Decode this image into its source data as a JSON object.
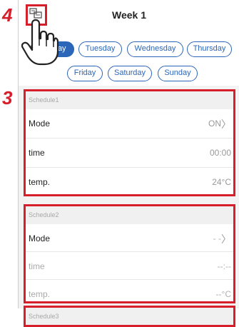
{
  "steps": {
    "step4": "4",
    "step3": "3"
  },
  "header": {
    "title": "Week 1",
    "icon": "copy-schedule-icon"
  },
  "days": [
    "Monday",
    "Tuesday",
    "Wednesday",
    "Thursday",
    "Friday",
    "Saturday",
    "Sunday"
  ],
  "selected_day": "Monday",
  "schedules": [
    {
      "name": "Schedule1",
      "rows": [
        {
          "label": "Mode",
          "value": "ON"
        },
        {
          "label": "time",
          "value": "00:00"
        },
        {
          "label": "temp.",
          "value": "24°C"
        }
      ]
    },
    {
      "name": "Schedule2",
      "rows": [
        {
          "label": "Mode",
          "value": "- -"
        },
        {
          "label": "time",
          "value": "--:--"
        },
        {
          "label": "temp.",
          "value": "--°C"
        }
      ]
    },
    {
      "name": "Schedule3",
      "rows": []
    }
  ],
  "colors": {
    "accent": "#2b66b8",
    "highlight": "#d61f2b"
  }
}
